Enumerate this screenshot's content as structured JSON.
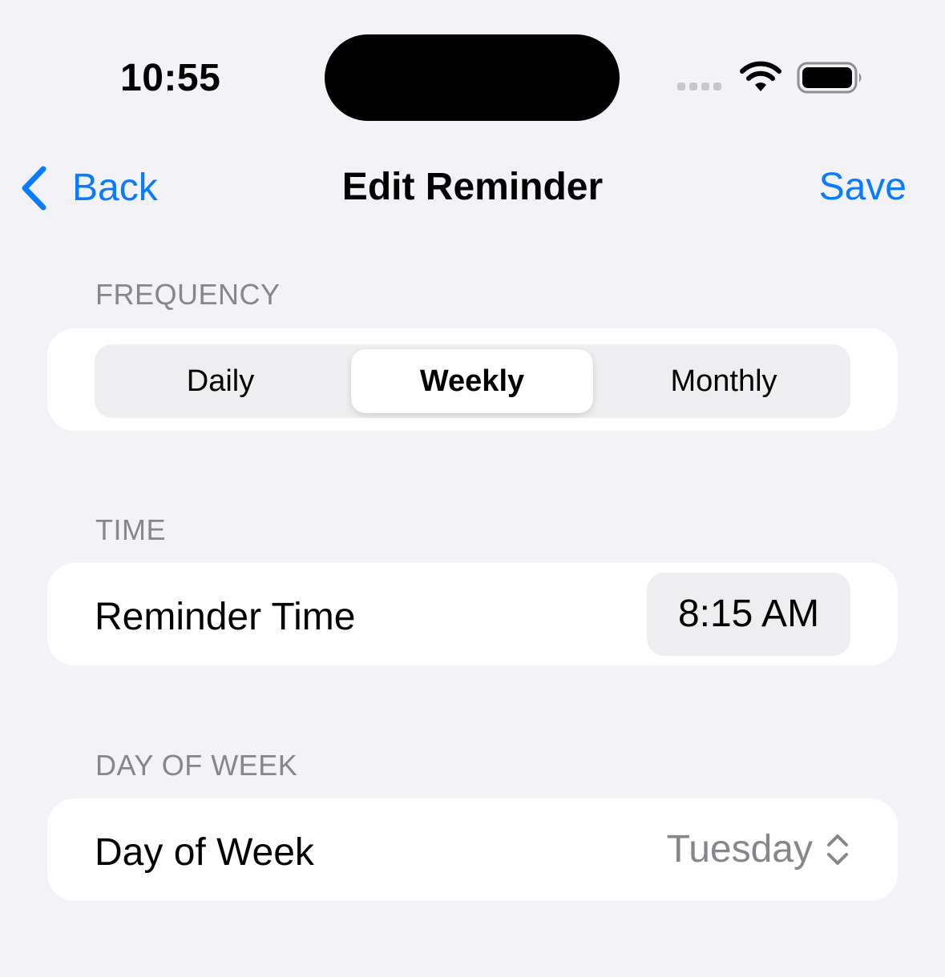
{
  "status_bar": {
    "time": "10:55",
    "icons": [
      "cellular-signal-icon",
      "wifi-icon",
      "battery-icon"
    ]
  },
  "nav": {
    "back_label": "Back",
    "back_icon": "chevron-left-icon",
    "title": "Edit Reminder",
    "save_label": "Save"
  },
  "colors": {
    "accent": "#0a7aff",
    "background": "#f2f2f7",
    "card": "#ffffff",
    "secondary_text": "#86868b",
    "control_fill": "#eeeef0"
  },
  "sections": {
    "frequency": {
      "header": "FREQUENCY",
      "options": [
        {
          "label": "Daily",
          "selected": false
        },
        {
          "label": "Weekly",
          "selected": true
        },
        {
          "label": "Monthly",
          "selected": false
        }
      ],
      "selected": "Weekly"
    },
    "time": {
      "header": "TIME",
      "row_label": "Reminder Time",
      "value": "8:15 AM"
    },
    "day_of_week": {
      "header": "DAY OF WEEK",
      "row_label": "Day of Week",
      "value": "Tuesday",
      "icon": "chevron-up-down-icon"
    }
  }
}
